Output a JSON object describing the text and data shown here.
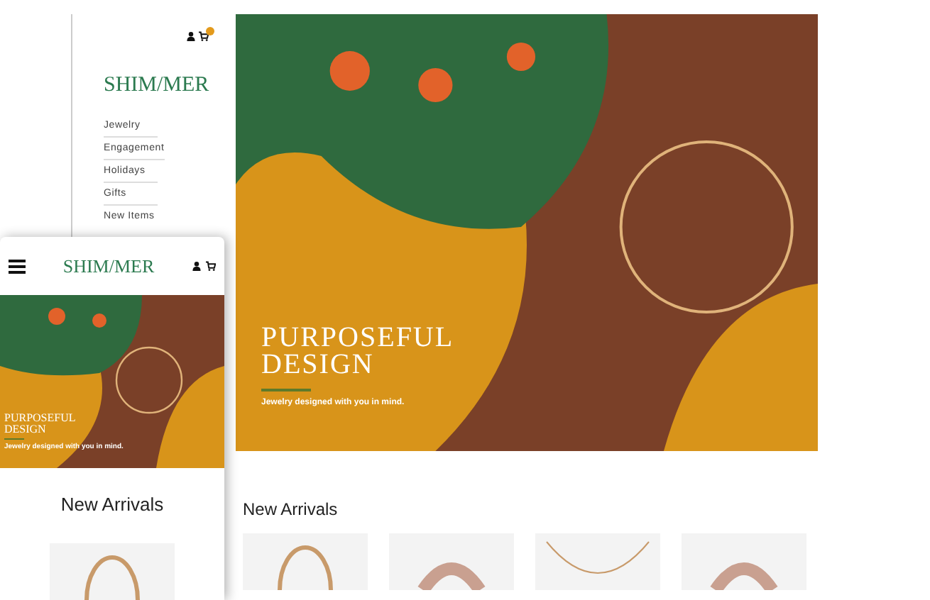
{
  "desktop": {
    "logo": "SHIM/MER",
    "nav": [
      {
        "label": "Jewelry"
      },
      {
        "label": "Engagement"
      },
      {
        "label": "Holidays"
      },
      {
        "label": "Gifts"
      },
      {
        "label": "New Items"
      }
    ],
    "hero": {
      "title": [
        "PURPOSEFUL",
        "DESIGN"
      ],
      "tagline": "Jewelry designed with you in mind."
    },
    "new_arrivals": {
      "heading": "New Arrivals",
      "products": [
        {
          "kind": "bracelet"
        },
        {
          "kind": "ring"
        },
        {
          "kind": "necklace"
        },
        {
          "kind": "ring"
        }
      ]
    }
  },
  "mobile": {
    "logo": "SHIM/MER",
    "hero": {
      "title": [
        "PURPOSEFUL",
        "DESIGN"
      ],
      "tagline": "Jewelry designed with you in mind."
    },
    "new_arrivals": {
      "heading": "New Arrivals",
      "products": [
        {
          "kind": "bracelet"
        }
      ]
    }
  }
}
